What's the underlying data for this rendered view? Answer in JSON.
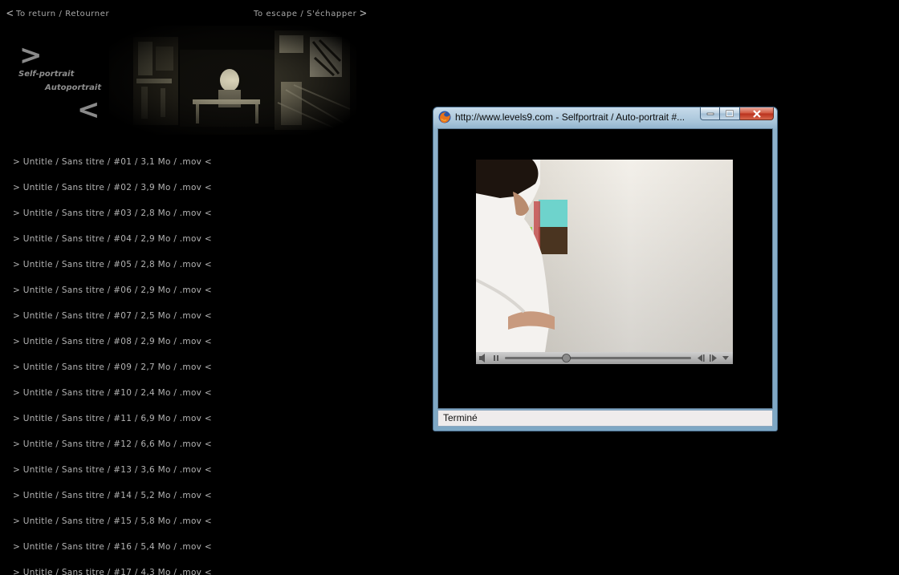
{
  "nav": {
    "return_label": "To return / Retourner",
    "escape_label": "To escape / S'échapper",
    "left_arrow": "<",
    "right_arrow": ">"
  },
  "header": {
    "gt": ">",
    "lt": "<",
    "title_en": "Self-portrait",
    "title_fr": "Autoportrait"
  },
  "videos": [
    "> Untitle / Sans titre / #01 / 3,1 Mo / .mov <",
    "> Untitle / Sans titre / #02 / 3,9 Mo / .mov <",
    "> Untitle / Sans titre / #03 / 2,8 Mo / .mov <",
    "> Untitle / Sans titre / #04 / 2,9 Mo / .mov <",
    "> Untitle / Sans titre / #05 / 2,8 Mo / .mov <",
    "> Untitle / Sans titre / #06 / 2,9 Mo / .mov <",
    "> Untitle / Sans titre / #07 / 2,5 Mo / .mov <",
    "> Untitle / Sans titre / #08 / 2,9 Mo / .mov <",
    "> Untitle / Sans titre / #09 / 2,7 Mo / .mov <",
    "> Untitle / Sans titre / #10 / 2,4 Mo / .mov <",
    "> Untitle / Sans titre / #11 / 6,9 Mo / .mov <",
    "> Untitle / Sans titre / #12 / 6,6 Mo / .mov <",
    "> Untitle / Sans titre / #13 / 3,6 Mo / .mov <",
    "> Untitle / Sans titre / #14 / 5,2 Mo / .mov <",
    "> Untitle / Sans titre / #15 / 5,8 Mo / .mov <",
    "> Untitle / Sans titre / #16 / 5,4 Mo / .mov <",
    "> Untitle / Sans titre / #17 / 4,3 Mo / .mov <"
  ],
  "popup": {
    "title": "http://www.levels9.com - Selfportrait / Auto-portrait #...",
    "status": "Terminé",
    "playback_position": 0.33
  },
  "colors": {
    "page_bg": "#000000",
    "list_text": "#b3b3b3",
    "logo_grey": "#8a8a8a",
    "window_frame": "#8eb2cc",
    "close_button": "#c7432b"
  },
  "icons": {
    "window": "firefox-icon",
    "volume": "speaker-icon",
    "play_state": "pause-icon"
  }
}
